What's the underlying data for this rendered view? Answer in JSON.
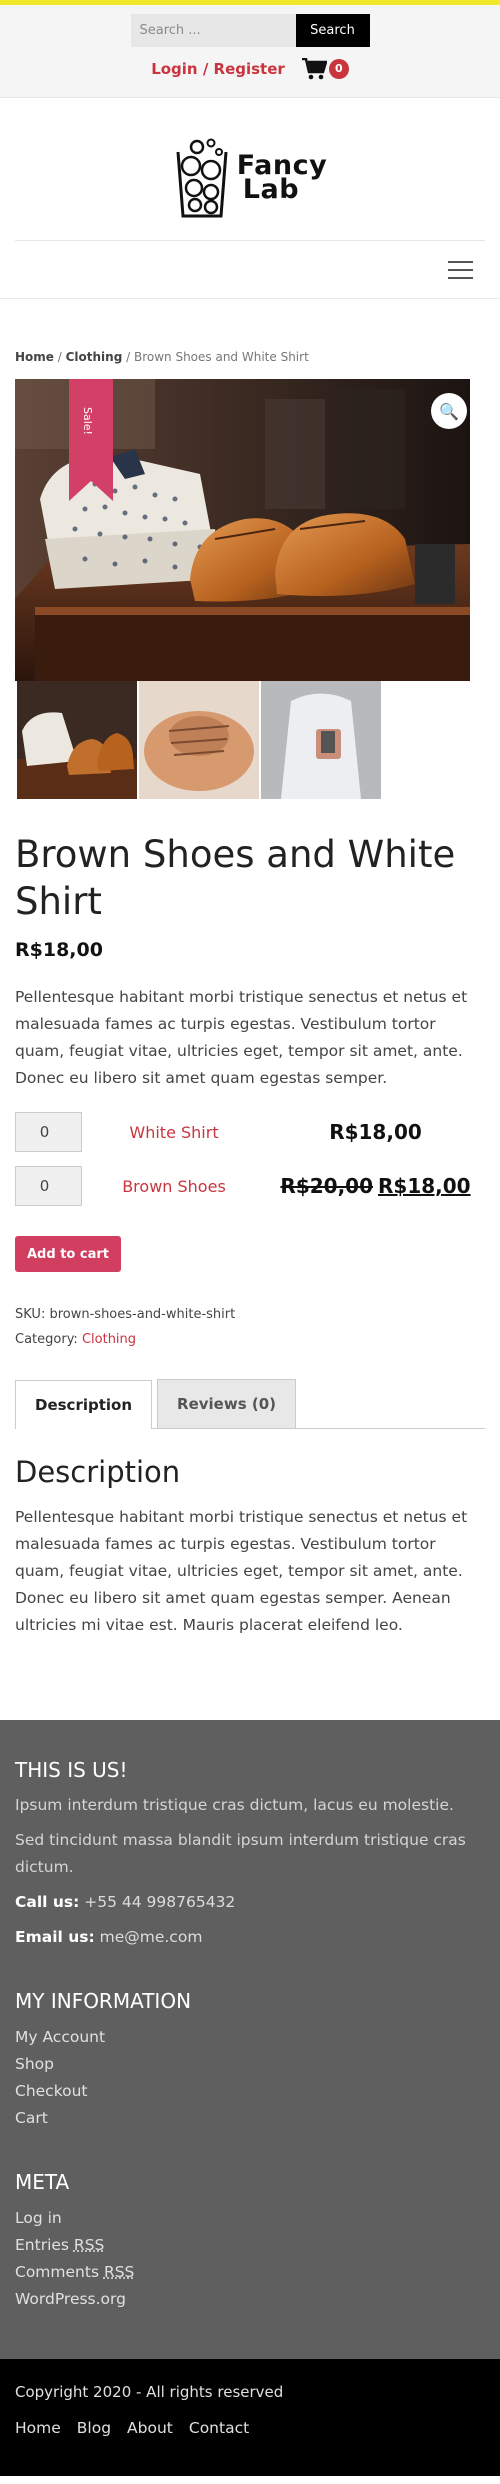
{
  "header": {
    "search_placeholder": "Search ...",
    "search_button": "Search",
    "login_register": "Login / Register",
    "cart_count": "0"
  },
  "logo": {
    "line1": "Fancy",
    "line2": "Lab"
  },
  "breadcrumb": {
    "home": "Home",
    "sep1": " / ",
    "category": "Clothing",
    "sep2": " / ",
    "current": "Brown Shoes and White Shirt"
  },
  "gallery": {
    "sale_label": "Sale!",
    "zoom_icon": "🔍"
  },
  "product": {
    "title": "Brown Shoes and White Shirt",
    "price": "R$18,00",
    "short_description": "Pellentesque habitant morbi tristique senectus et netus et malesuada fames ac turpis egestas. Vestibulum tortor quam, feugiat vitae, ultricies eget, tempor sit amet, ante. Donec eu libero sit amet quam egestas semper.",
    "grouped_items": [
      {
        "qty": "0",
        "name": "White Shirt",
        "old_price": "",
        "price": "R$18,00"
      },
      {
        "qty": "0",
        "name": "Brown Shoes",
        "old_price": "R$20,00",
        "price": "R$18,00"
      }
    ],
    "add_to_cart": "Add to cart",
    "sku_label": "SKU: ",
    "sku": "brown-shoes-and-white-shirt",
    "category_label": "Category: ",
    "category": "Clothing"
  },
  "tabs": [
    {
      "label": "Description"
    },
    {
      "label": "Reviews (0)"
    }
  ],
  "description": {
    "title": "Description",
    "text": "Pellentesque habitant morbi tristique senectus et netus et malesuada fames ac turpis egestas. Vestibulum tortor quam, feugiat vitae, ultricies eget, tempor sit amet, ante. Donec eu libero sit amet quam egestas semper. Aenean ultricies mi vitae est. Mauris placerat eleifend leo."
  },
  "footer": {
    "about_title": "THIS IS US!",
    "about_text1": "Ipsum interdum tristique cras dictum, lacus eu molestie.",
    "about_text2": "Sed tincidunt massa blandit ipsum interdum tristique cras dictum.",
    "call_label": "Call us:",
    "call_value": " +55 44 998765432",
    "email_label": "Email us:",
    "email_value": " me@me.com",
    "info_title": "MY INFORMATION",
    "info_links": [
      "My Account",
      "Shop",
      "Checkout",
      "Cart"
    ],
    "meta_title": "META",
    "meta_login": "Log in",
    "meta_entries": "Entries ",
    "meta_comments": "Comments ",
    "meta_rss": "RSS",
    "meta_wp": "WordPress.org"
  },
  "bottom": {
    "copyright": "Copyright 2020 - All rights reserved",
    "nav": [
      "Home",
      "Blog",
      "About",
      "Contact"
    ]
  },
  "colors": {
    "accent_red": "#c9353f",
    "sale_pink": "#d23f67",
    "top_yellow": "#f2e82a",
    "footer_gray": "#5f5f5f"
  }
}
